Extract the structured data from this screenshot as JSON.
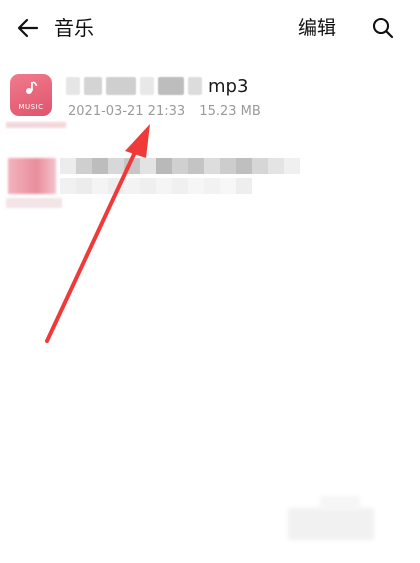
{
  "header": {
    "back_icon": "arrow-left-icon",
    "title": "音乐",
    "edit_label": "编辑",
    "search_icon": "search-icon"
  },
  "files": [
    {
      "icon": "music-icon",
      "icon_label": "MUSIC",
      "name_visible_suffix": "mp3",
      "date": "2021-03-21 21:33",
      "size": "15.23 MB"
    }
  ],
  "colors": {
    "music_icon": "#e0546c",
    "annotation_arrow": "#f03a3a",
    "meta_text": "#9a9a9a"
  }
}
